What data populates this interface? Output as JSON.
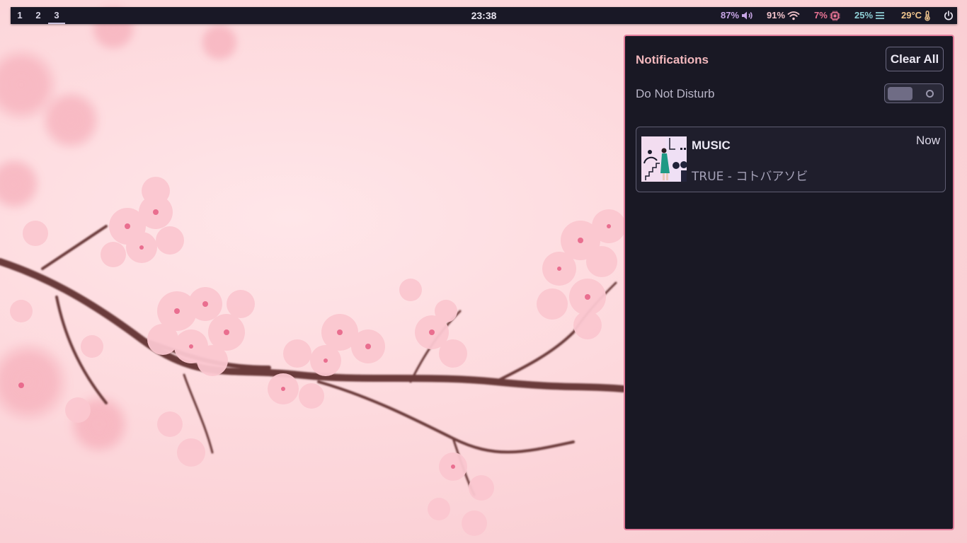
{
  "topbar": {
    "workspaces": [
      {
        "label": "1",
        "active": false
      },
      {
        "label": "2",
        "active": false
      },
      {
        "label": "3",
        "active": true
      }
    ],
    "clock": "23:38",
    "modules": {
      "volume": {
        "value": "87%",
        "icon": "volume-icon",
        "color": "#c8a6e6"
      },
      "wifi": {
        "value": "91%",
        "icon": "wifi-icon",
        "color": "#f2c4cc"
      },
      "cpu": {
        "value": "7%",
        "icon": "cpu-icon",
        "color": "#ec7596"
      },
      "memory": {
        "value": "25%",
        "icon": "memory-icon",
        "color": "#8fcfd6"
      },
      "temperature": {
        "value": "29°C",
        "icon": "thermometer-icon",
        "color": "#f0c58e"
      },
      "power": {
        "icon": "power-icon",
        "color": "#e6e3ee"
      }
    }
  },
  "notification_center": {
    "title": "Notifications",
    "clear_all_label": "Clear All",
    "dnd_label": "Do Not Disturb",
    "dnd_enabled": false,
    "notifications": [
      {
        "app": "MUSIC",
        "time": "Now",
        "body": "TRUE - コトバアソビ",
        "icon": "album-art-image"
      }
    ]
  },
  "colors": {
    "panel_bg": "#191824",
    "panel_border": "#e17b9a",
    "title": "#f2b8bd",
    "bar_bg": "#191826"
  }
}
